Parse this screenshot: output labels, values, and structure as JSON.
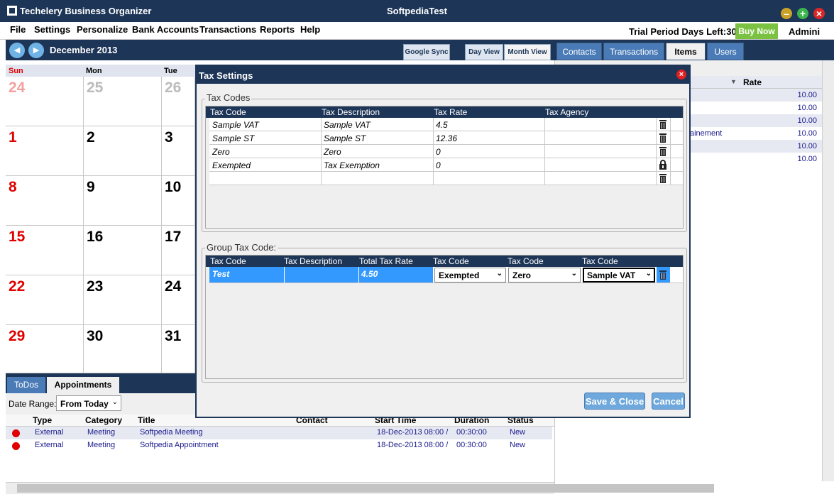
{
  "window": {
    "app_title": "Techelery Business Organizer",
    "title": "SoftpediaTest",
    "trial_text": "Trial Period Days Left:30",
    "buy_now": "Buy Now",
    "user": "Admini"
  },
  "menu": [
    "File",
    "Settings",
    "Personalize",
    "Bank Accounts",
    "Transactions",
    "Reports",
    "Help"
  ],
  "calendar": {
    "month": "December 2013",
    "buttons": {
      "google_sync": "Google Sync",
      "day_view": "Day View",
      "month_view": "Month View"
    },
    "day_names": [
      "Sun",
      "Mon",
      "Tue"
    ],
    "weeks": [
      [
        "24",
        "25",
        "26"
      ],
      [
        "1",
        "2",
        "3"
      ],
      [
        "8",
        "9",
        "10"
      ],
      [
        "15",
        "16",
        "17"
      ],
      [
        "22",
        "23",
        "24"
      ],
      [
        "29",
        "30",
        "31"
      ]
    ]
  },
  "right_panel": {
    "tabs": [
      "Contacts",
      "Transactions",
      "Items",
      "Users"
    ],
    "col_rate": "Rate",
    "rates": [
      "10.00",
      "10.00",
      "10.00",
      "10.00",
      "10.00",
      "10.00"
    ],
    "partial_text": "ainement"
  },
  "bottom": {
    "tabs": [
      "ToDos",
      "Appointments"
    ],
    "date_range_label": "Date Range:",
    "date_range_value": "From Today",
    "columns": [
      "Type",
      "Category",
      "Title",
      "Contact",
      "Start Time",
      "Duration",
      "Status"
    ],
    "rows": [
      {
        "type": "External",
        "category": "Meeting",
        "title": "Softpedia Meeting",
        "start": "18-Dec-2013 08:00 /",
        "duration": "00:30:00",
        "status": "New"
      },
      {
        "type": "External",
        "category": "Meeting",
        "title": "Softpedia Appointment",
        "start": "18-Dec-2013 08:00 /",
        "duration": "00:30:00",
        "status": "New"
      }
    ]
  },
  "modal": {
    "title": "Tax Settings",
    "tax_codes_title": "Tax Codes",
    "tax_codes_columns": [
      "Tax Code",
      "Tax Description",
      "Tax Rate",
      "Tax Agency"
    ],
    "tax_codes": [
      {
        "code": "Sample VAT",
        "desc": "Sample VAT",
        "rate": "4.5",
        "agency": ""
      },
      {
        "code": "Sample ST",
        "desc": "Sample ST",
        "rate": "12.36",
        "agency": ""
      },
      {
        "code": "Zero",
        "desc": "Zero",
        "rate": "0",
        "agency": ""
      },
      {
        "code": "Exempted",
        "desc": "Tax Exemption",
        "rate": "0",
        "agency": ""
      }
    ],
    "group_title": "Group Tax Code:",
    "group_columns": [
      "Tax Code",
      "Tax Description",
      "Total Tax Rate",
      "Tax Code",
      "Tax Code",
      "Tax Code"
    ],
    "group_row": {
      "code": "Test",
      "desc": "",
      "total": "4.50",
      "code1": "Exempted",
      "code2": "Zero",
      "code3": "Sample VAT"
    },
    "save_close": "Save & Close",
    "cancel": "Cancel"
  },
  "colors": {
    "navy": "#1d3557",
    "tab_blue": "#4a7bb7",
    "selection": "#3399ff",
    "red_day": "#e00000",
    "buy_green": "#7cc242"
  }
}
